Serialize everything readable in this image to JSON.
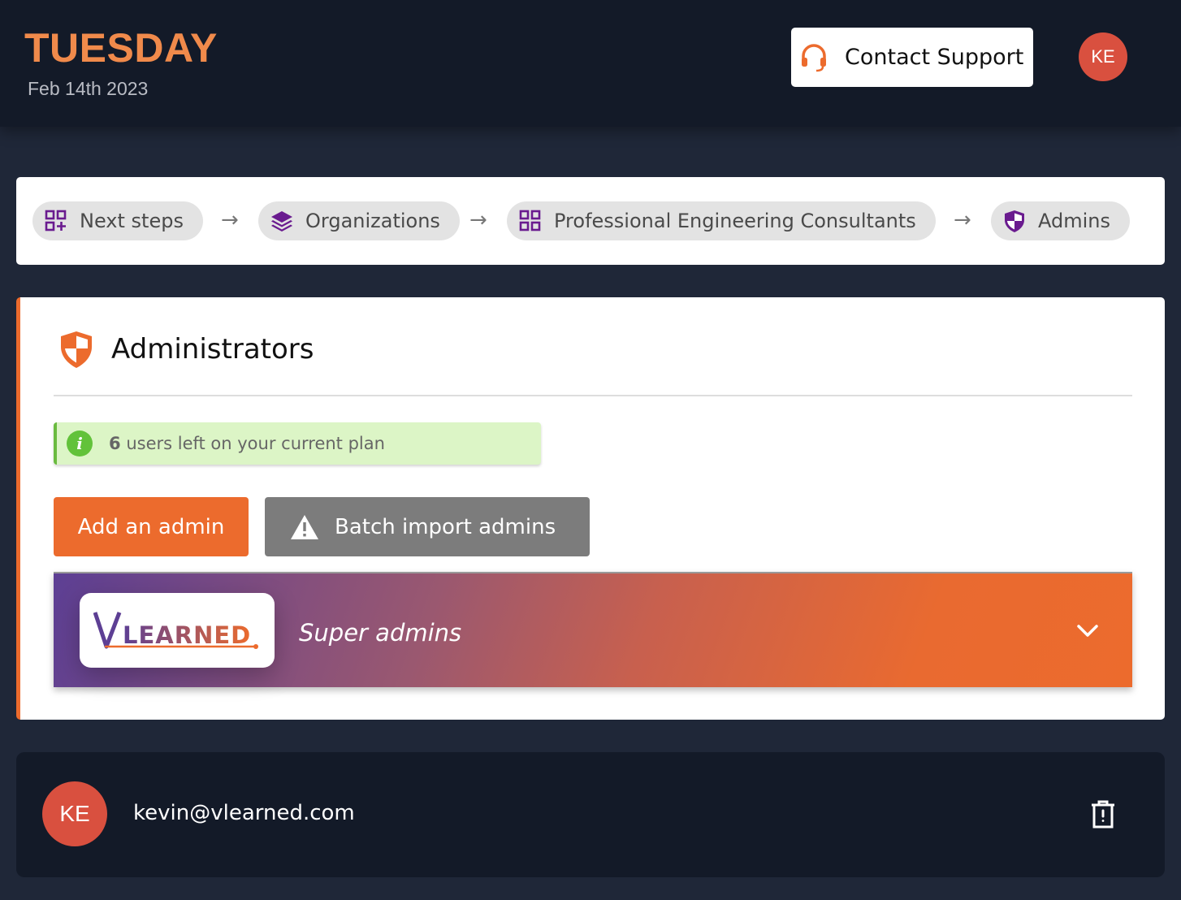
{
  "header": {
    "day": "TUESDAY",
    "date": "Feb 14th 2023",
    "support_label": "Contact Support",
    "support_icon": "headset-icon",
    "avatar_initials": "KE"
  },
  "breadcrumb": {
    "items": [
      {
        "label": "Next steps",
        "icon": "grid-plus-icon"
      },
      {
        "label": "Organizations",
        "icon": "layers-icon"
      },
      {
        "label": "Professional Engineering Consultants",
        "icon": "grid-icon"
      },
      {
        "label": "Admins",
        "icon": "shield-icon"
      }
    ],
    "separator": "→"
  },
  "admins": {
    "title": "Administrators",
    "title_icon": "shield-icon",
    "notice_count": "6",
    "notice_text": "users left on your current plan",
    "add_label": "Add an admin",
    "batch_label": "Batch import admins",
    "group": {
      "logo_text": "VLEARNED",
      "title": "Super admins"
    }
  },
  "users": [
    {
      "initials": "KE",
      "email": "kevin@vlearned.com"
    }
  ],
  "colors": {
    "accent": "#ec6b2d",
    "header_bg": "#131a28",
    "page_bg": "#1f2738",
    "icon_purple": "#6a1b8f",
    "avatar": "#d9503f"
  }
}
